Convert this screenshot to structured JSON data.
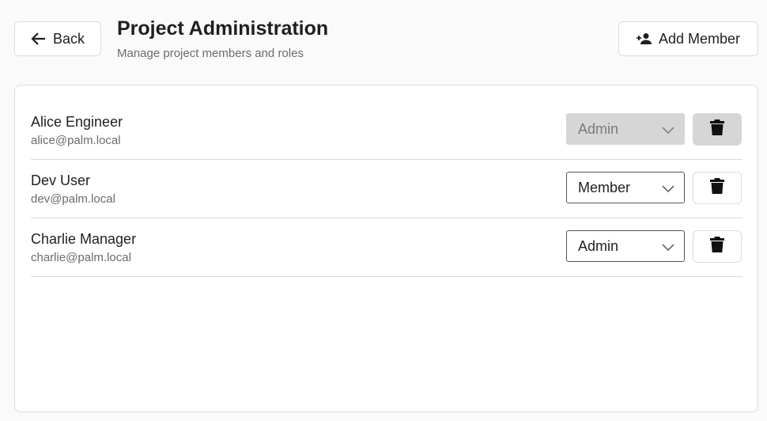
{
  "header": {
    "back_label": "Back",
    "title": "Project Administration",
    "subtitle": "Manage project members and roles",
    "add_member_label": "Add Member"
  },
  "members": [
    {
      "name": "Alice Engineer",
      "email": "alice@palm.local",
      "role": "Admin",
      "disabled": true
    },
    {
      "name": "Dev User",
      "email": "dev@palm.local",
      "role": "Member",
      "disabled": false
    },
    {
      "name": "Charlie Manager",
      "email": "charlie@palm.local",
      "role": "Admin",
      "disabled": false
    }
  ],
  "icons": {
    "back": "arrow-left-icon",
    "add_member": "person-add-icon",
    "delete": "trash-icon",
    "dropdown": "chevron-down-icon"
  },
  "colors": {
    "disabled_bg": "#d6d6d6",
    "border": "#dcdcdc",
    "text": "#1f1f1f",
    "muted_text": "#6b6b6b"
  }
}
